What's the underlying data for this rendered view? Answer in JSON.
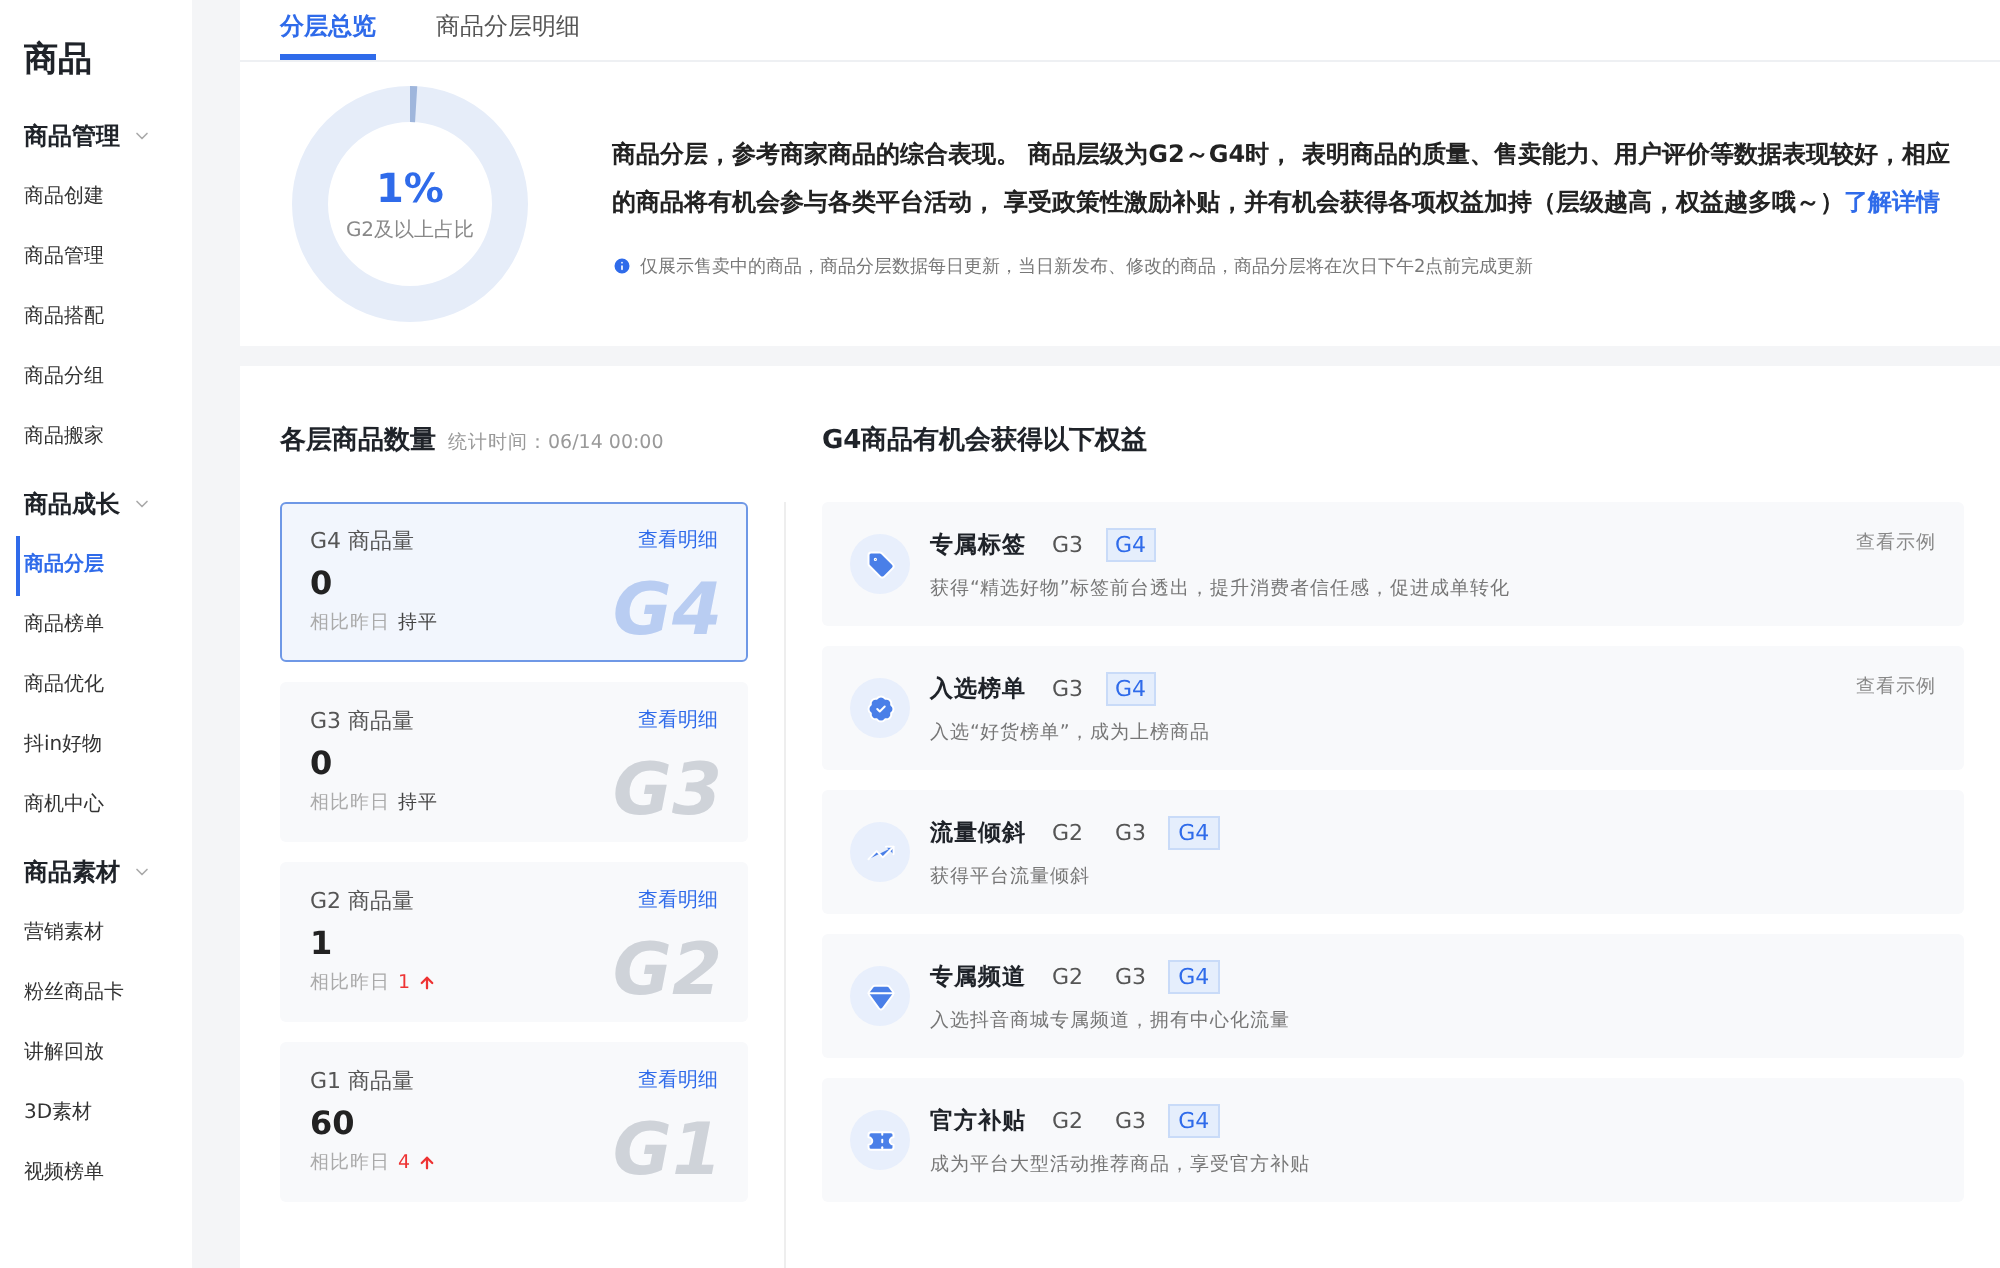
{
  "sidebar": {
    "title": "商品",
    "groups": [
      {
        "label": "商品管理",
        "expanded": true,
        "items": [
          {
            "label": "商品创建",
            "selected": false
          },
          {
            "label": "商品管理",
            "selected": false
          },
          {
            "label": "商品搭配",
            "selected": false
          },
          {
            "label": "商品分组",
            "selected": false
          },
          {
            "label": "商品搬家",
            "selected": false
          }
        ]
      },
      {
        "label": "商品成长",
        "expanded": true,
        "items": [
          {
            "label": "商品分层",
            "selected": true
          },
          {
            "label": "商品榜单",
            "selected": false
          },
          {
            "label": "商品优化",
            "selected": false
          },
          {
            "label": "抖in好物",
            "selected": false
          },
          {
            "label": "商机中心",
            "selected": false
          }
        ]
      },
      {
        "label": "商品素材",
        "expanded": true,
        "items": [
          {
            "label": "营销素材",
            "selected": false
          },
          {
            "label": "粉丝商品卡",
            "selected": false
          },
          {
            "label": "讲解回放",
            "selected": false
          },
          {
            "label": "3D素材",
            "selected": false
          },
          {
            "label": "视频榜单",
            "selected": false
          }
        ]
      }
    ]
  },
  "tabs": [
    {
      "label": "分层总览",
      "selected": true
    },
    {
      "label": "商品分层明细",
      "selected": false
    }
  ],
  "overview": {
    "donut": {
      "level": 0.01,
      "value": "1%",
      "caption": "G2及以上占比"
    },
    "description": "商品分层，参考商家商品的综合表现。 商品层级为G2～G4时， 表明商品的质量、售卖能力、用户评价等数据表现较好，相应的商品将有机会参与各类平台活动， 享受政策性激励补贴，并有机会获得各项权益加持（层级越高，权益越多哦～）",
    "link": "了解详情",
    "note": "仅展示售卖中的商品，商品分层数据每日更新，当日新发布、修改的商品，商品分层将在次日下午2点前完成更新"
  },
  "counts": {
    "title": "各层商品数量",
    "stat_time": "统计时间：06/14 00:00",
    "cards": [
      {
        "label": "G4 商品量",
        "link": "查看明细",
        "value": "0",
        "compare_label": "相比昨日",
        "compare_value": "持平",
        "rising": false,
        "bg_label": "G4",
        "selected": true
      },
      {
        "label": "G3 商品量",
        "link": "查看明细",
        "value": "0",
        "compare_label": "相比昨日",
        "compare_value": "持平",
        "rising": false,
        "bg_label": "G3",
        "selected": false
      },
      {
        "label": "G2 商品量",
        "link": "查看明细",
        "value": "1",
        "compare_label": "相比昨日",
        "compare_value": "1",
        "rising": true,
        "bg_label": "G2",
        "selected": false
      },
      {
        "label": "G1 商品量",
        "link": "查看明细",
        "value": "60",
        "compare_label": "相比昨日",
        "compare_value": "4",
        "rising": true,
        "bg_label": "G1",
        "selected": false
      }
    ]
  },
  "benefits": {
    "title": "G4商品有机会获得以下权益",
    "items": [
      {
        "kind": "tag",
        "title": "专属标签",
        "tiers": [
          {
            "label": "G3",
            "highlighted": false
          },
          {
            "label": "G4",
            "highlighted": true
          }
        ],
        "description": "获得“精选好物”标签前台透出，提升消费者信任感，促进成单转化",
        "action": "查看示例"
      },
      {
        "kind": "badge",
        "title": "入选榜单",
        "tiers": [
          {
            "label": "G3",
            "highlighted": false
          },
          {
            "label": "G4",
            "highlighted": true
          }
        ],
        "description": "入选“好货榜单”，成为上榜商品",
        "action": "查看示例"
      },
      {
        "kind": "chart",
        "title": "流量倾斜",
        "tiers": [
          {
            "label": "G2",
            "highlighted": false
          },
          {
            "label": "G3",
            "highlighted": false
          },
          {
            "label": "G4",
            "highlighted": true
          }
        ],
        "description": "获得平台流量倾斜"
      },
      {
        "kind": "gem",
        "title": "专属频道",
        "tiers": [
          {
            "label": "G2",
            "highlighted": false
          },
          {
            "label": "G3",
            "highlighted": false
          },
          {
            "label": "G4",
            "highlighted": true
          }
        ],
        "description": "入选抖音商城专属频道，拥有中心化流量"
      },
      {
        "kind": "ticket",
        "title": "官方补贴",
        "tiers": [
          {
            "label": "G2",
            "highlighted": false
          },
          {
            "label": "G3",
            "highlighted": false
          },
          {
            "label": "G4",
            "highlighted": true
          }
        ],
        "description": "成为平台大型活动推荐商品，享受官方补贴"
      }
    ]
  }
}
